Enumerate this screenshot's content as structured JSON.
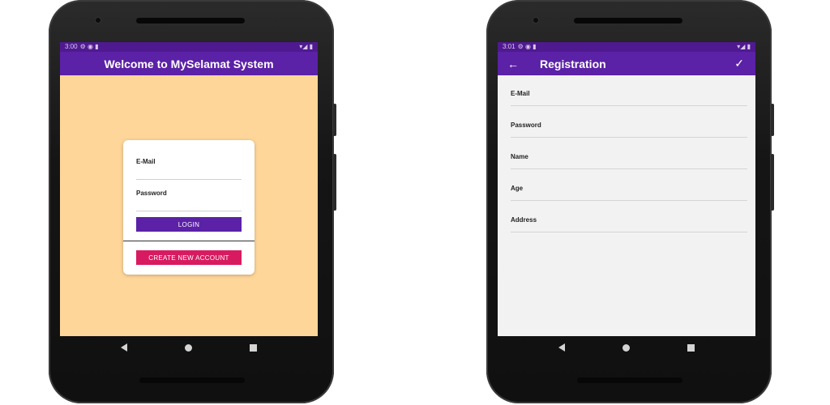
{
  "left_screen": {
    "status": {
      "time": "3:00",
      "left_icons": "⚙ ◉ ▮",
      "right_icons": "▾◢ ▮"
    },
    "app_bar": {
      "title": "Welcome to MySelamat System"
    },
    "login_card": {
      "email_label": "E-Mail",
      "password_label": "Password",
      "login_label": "LOGIN",
      "create_account_label": "CREATE NEW ACCOUNT"
    }
  },
  "right_screen": {
    "status": {
      "time": "3:01",
      "left_icons": "⚙ ◉ ▮",
      "right_icons": "▾◢ ▮"
    },
    "app_bar": {
      "title": "Registration",
      "back_icon": "←",
      "check_icon": "✓"
    },
    "fields": [
      {
        "label": "E-Mail"
      },
      {
        "label": "Password"
      },
      {
        "label": "Name"
      },
      {
        "label": "Age"
      },
      {
        "label": "Address"
      }
    ]
  },
  "colors": {
    "app_bar": "#5b21a6",
    "status_bar": "#4f1a8f",
    "login_background": "#ffd699",
    "login_button": "#5b21a6",
    "create_account_button": "#d81b60",
    "registration_background": "#f2f2f2"
  },
  "icons": {
    "back": "arrow-left-icon",
    "confirm": "check-icon",
    "nav": [
      "nav-back-icon",
      "nav-home-icon",
      "nav-recent-icon"
    ]
  }
}
